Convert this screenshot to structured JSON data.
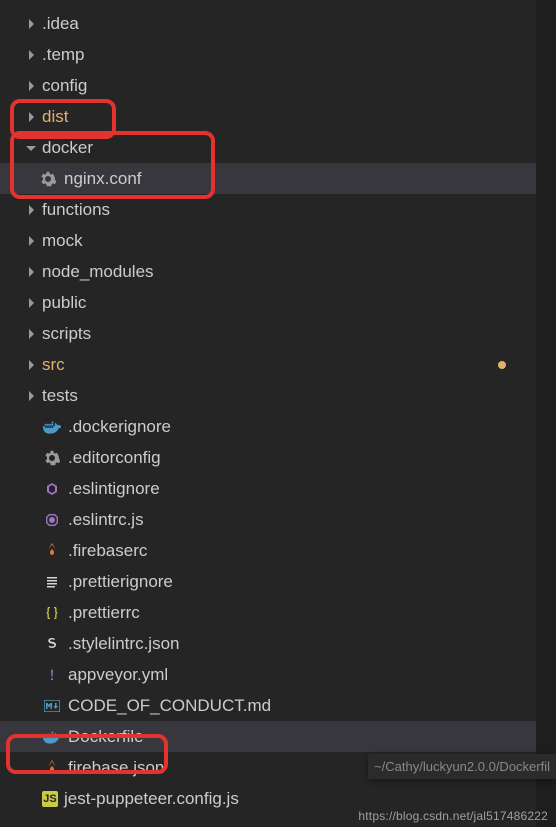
{
  "tree": {
    "idea": ".idea",
    "temp": ".temp",
    "config": "config",
    "dist": "dist",
    "docker": "docker",
    "nginx_conf": "nginx.conf",
    "functions": "functions",
    "mock": "mock",
    "node_modules": "node_modules",
    "public": "public",
    "scripts": "scripts",
    "src": "src",
    "tests": "tests",
    "dockerignore": ".dockerignore",
    "editorconfig": ".editorconfig",
    "eslintignore": ".eslintignore",
    "eslintrc_js": ".eslintrc.js",
    "firebaserc": ".firebaserc",
    "prettierignore": ".prettierignore",
    "prettierrc": ".prettierrc",
    "stylelintrc_json": ".stylelintrc.json",
    "appveyor_yml": "appveyor.yml",
    "code_of_conduct": "CODE_OF_CONDUCT.md",
    "dockerfile": "Dockerfile",
    "firebase_json": "firebase.json",
    "jest_puppeteer": "jest-puppeteer.config.js"
  },
  "pathbar": "~/Cathy/luckyun2.0.0/Dockerfil",
  "watermark": "https://blog.csdn.net/jal517486222"
}
